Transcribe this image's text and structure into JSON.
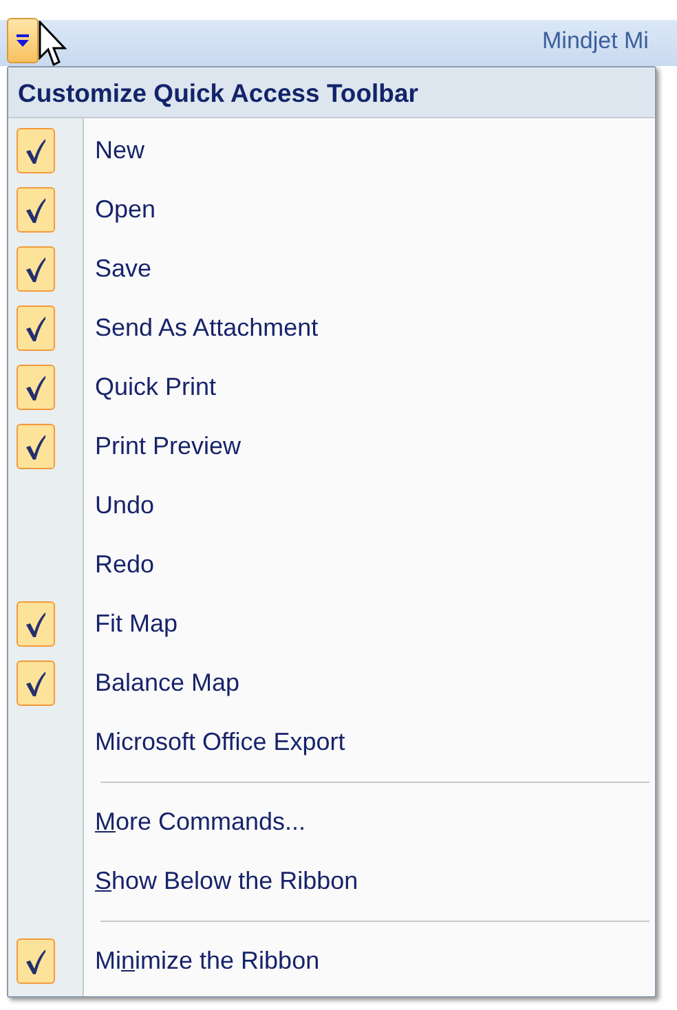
{
  "title_bar": {
    "title": "Mindjet Mi"
  },
  "menu": {
    "title": "Customize Quick Access Toolbar",
    "groups": [
      [
        {
          "label": "New",
          "checked": true
        },
        {
          "label": "Open",
          "checked": true
        },
        {
          "label": "Save",
          "checked": true
        },
        {
          "label": "Send As Attachment",
          "checked": true
        },
        {
          "label": "Quick Print",
          "checked": true
        },
        {
          "label": "Print Preview",
          "checked": true
        },
        {
          "label": "Undo",
          "checked": false
        },
        {
          "label": "Redo",
          "checked": false
        },
        {
          "label": "Fit Map",
          "checked": true
        },
        {
          "label": "Balance Map",
          "checked": true
        },
        {
          "label": "Microsoft Office Export",
          "checked": false
        }
      ],
      [
        {
          "access_key": "M",
          "label_after": "ore Commands...",
          "checked": false
        },
        {
          "access_key": "S",
          "label_after": "how Below the Ribbon",
          "checked": false
        }
      ],
      [
        {
          "label_before": "Mi",
          "access_key": "n",
          "label_after": "imize the Ribbon",
          "checked": true
        }
      ]
    ]
  }
}
